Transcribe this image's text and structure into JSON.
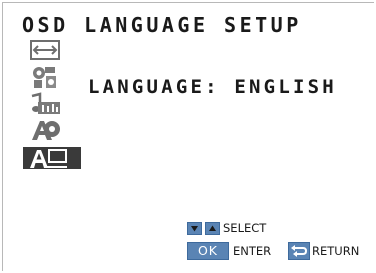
{
  "screen": {
    "title": "OSD LANGUAGE SETUP",
    "language_label": "LANGUAGE",
    "language_separator": ":",
    "language_value": "ENGLISH"
  },
  "menu_icons": [
    {
      "name": "picture-size-icon",
      "selected": false
    },
    {
      "name": "settings-icon",
      "selected": false
    },
    {
      "name": "audio-icon",
      "selected": false
    },
    {
      "name": "reset-icon",
      "selected": false
    },
    {
      "name": "osd-language-icon",
      "selected": true
    }
  ],
  "hints": {
    "select_label": "SELECT",
    "ok_key_label": "OK",
    "enter_label": "ENTER",
    "return_label": "RETURN"
  },
  "colors": {
    "key_blue": "#5a84b4",
    "selected_bg": "#3a3a3a",
    "icon_gray": "#6e6e6e"
  }
}
